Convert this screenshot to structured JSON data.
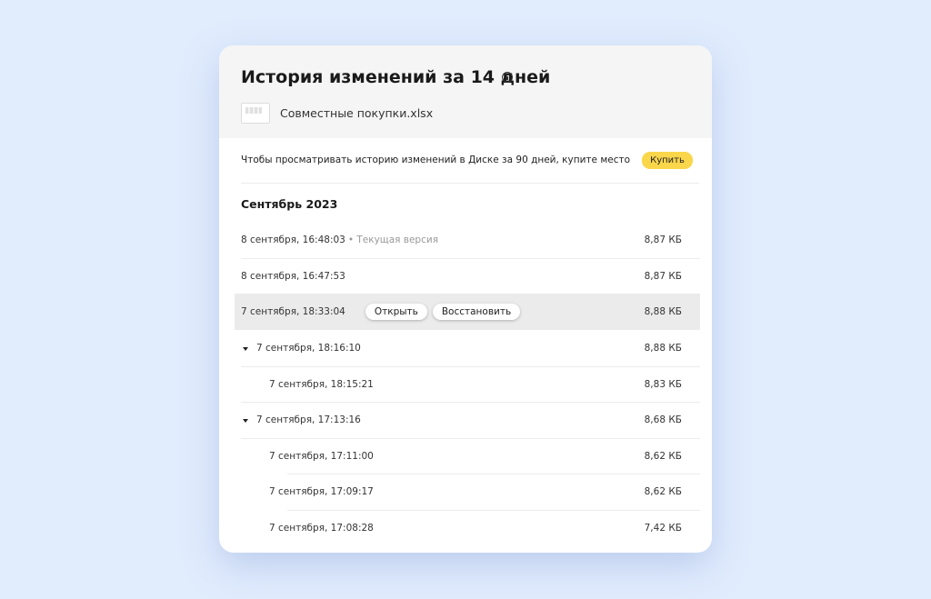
{
  "header": {
    "title": "История изменений за 14 дней",
    "info_icon": "info-icon",
    "file_name": "Совместные покупки.xlsx"
  },
  "promo": {
    "text": "Чтобы просматривать историю изменений в Диске за 90 дней, купите место",
    "button_label": "Купить"
  },
  "month": "Сентябрь 2023",
  "versions": [
    {
      "date": "8 сентября, 16:48:03",
      "note": "• Текущая версия",
      "size": "8,87 КБ"
    },
    {
      "date": "8 сентября, 16:47:53",
      "size": "8,87 КБ"
    },
    {
      "date": "7 сентября, 18:33:04",
      "size": "8,88 КБ",
      "open_label": "Открыть",
      "restore_label": "Восстановить"
    },
    {
      "date": "7 сентября, 18:16:10",
      "size": "8,88 КБ"
    },
    {
      "date": "7 сентября, 18:15:21",
      "size": "8,83 КБ"
    },
    {
      "date": "7 сентября, 17:13:16",
      "size": "8,68 КБ"
    },
    {
      "date": "7 сентября, 17:11:00",
      "size": "8,62 КБ"
    },
    {
      "date": "7 сентября, 17:09:17",
      "size": "8,62 КБ"
    },
    {
      "date": "7 сентября, 17:08:28",
      "size": "7,42 КБ"
    }
  ],
  "colors": {
    "background": "#e1ecfd",
    "highlight_row": "#ebebeb",
    "buy_button": "#fad64b",
    "header_bg": "#f5f5f5"
  }
}
